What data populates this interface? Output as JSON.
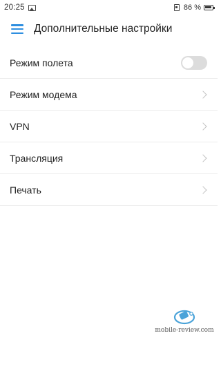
{
  "status_bar": {
    "time": "20:25",
    "battery": "86 %",
    "icons": [
      "gallery-icon",
      "sim-icon",
      "battery-icon"
    ]
  },
  "app_bar": {
    "title": "Дополнительные настройки",
    "menu_icon": "hamburger-menu-icon",
    "accent_color": "#2f8fe0"
  },
  "settings": [
    {
      "label": "Режим полета",
      "control": "toggle",
      "state": "off"
    },
    {
      "label": "Режим модема",
      "control": "chevron"
    },
    {
      "label": "VPN",
      "control": "chevron"
    },
    {
      "label": "Трансляция",
      "control": "chevron"
    },
    {
      "label": "Печать",
      "control": "chevron"
    }
  ],
  "watermark": {
    "text": "mobile-review.com",
    "logo_color": "#4aa3d9"
  }
}
